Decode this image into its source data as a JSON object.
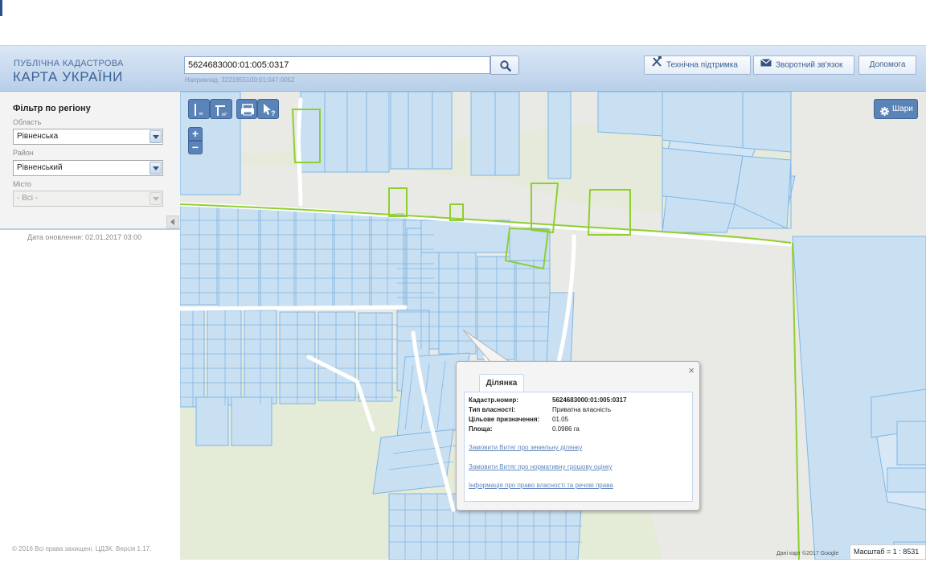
{
  "header": {
    "brand_small": "ПУБЛІЧНА КАДАСТРОВА",
    "brand_big": "КАРТА УКРАЇНИ",
    "search_value": "5624683000:01:005:0317",
    "search_hint": "Наприклад: 3221855100:01:047:0052",
    "support_label": "Технічна підтримка",
    "feedback_label": "Зворотний зв'язок",
    "help_label": "Допомога"
  },
  "sidebar": {
    "filter_title": "Фільтр по регіону",
    "region_label": "Область",
    "region_value": "Рівненська",
    "district_label": "Район",
    "district_value": "Рівненський",
    "city_label": "Місто",
    "city_value": "- Всі -",
    "update_date": "Дата оновлення: 02.01.2017 03:00",
    "copyright": "© 2016 Всі права захищені. ЦДЗК. Версія 1.17."
  },
  "map": {
    "layers_label": "Шари",
    "attribution": "Дані карт ©2017 Google",
    "scale": "Масштаб = 1 : 8531",
    "tools": [
      "measure-length",
      "measure-area",
      "print",
      "identify"
    ],
    "colors": {
      "parcel_fill": "#c9e0f3",
      "parcel_stroke": "#7fb6e4",
      "highlight_stroke": "#8fcf2f",
      "road": "#ffffff",
      "ui_blue": "#5a83b8"
    }
  },
  "popup": {
    "tab_label": "Ділянка",
    "rows": [
      {
        "key": "Кадастр.номер:",
        "value": "5624683000:01:005:0317"
      },
      {
        "key": "Тип власності:",
        "value": "Приватна власність"
      },
      {
        "key": "Цільове призначення:",
        "value": "01.05"
      },
      {
        "key": "Площа:",
        "value": "0.0986 га"
      }
    ],
    "links": [
      "Замовити Витяг про земельну ділянку",
      "Замовити Витяг про нормативну грошову оцінку",
      "Інформація про право власності та речові права"
    ]
  }
}
